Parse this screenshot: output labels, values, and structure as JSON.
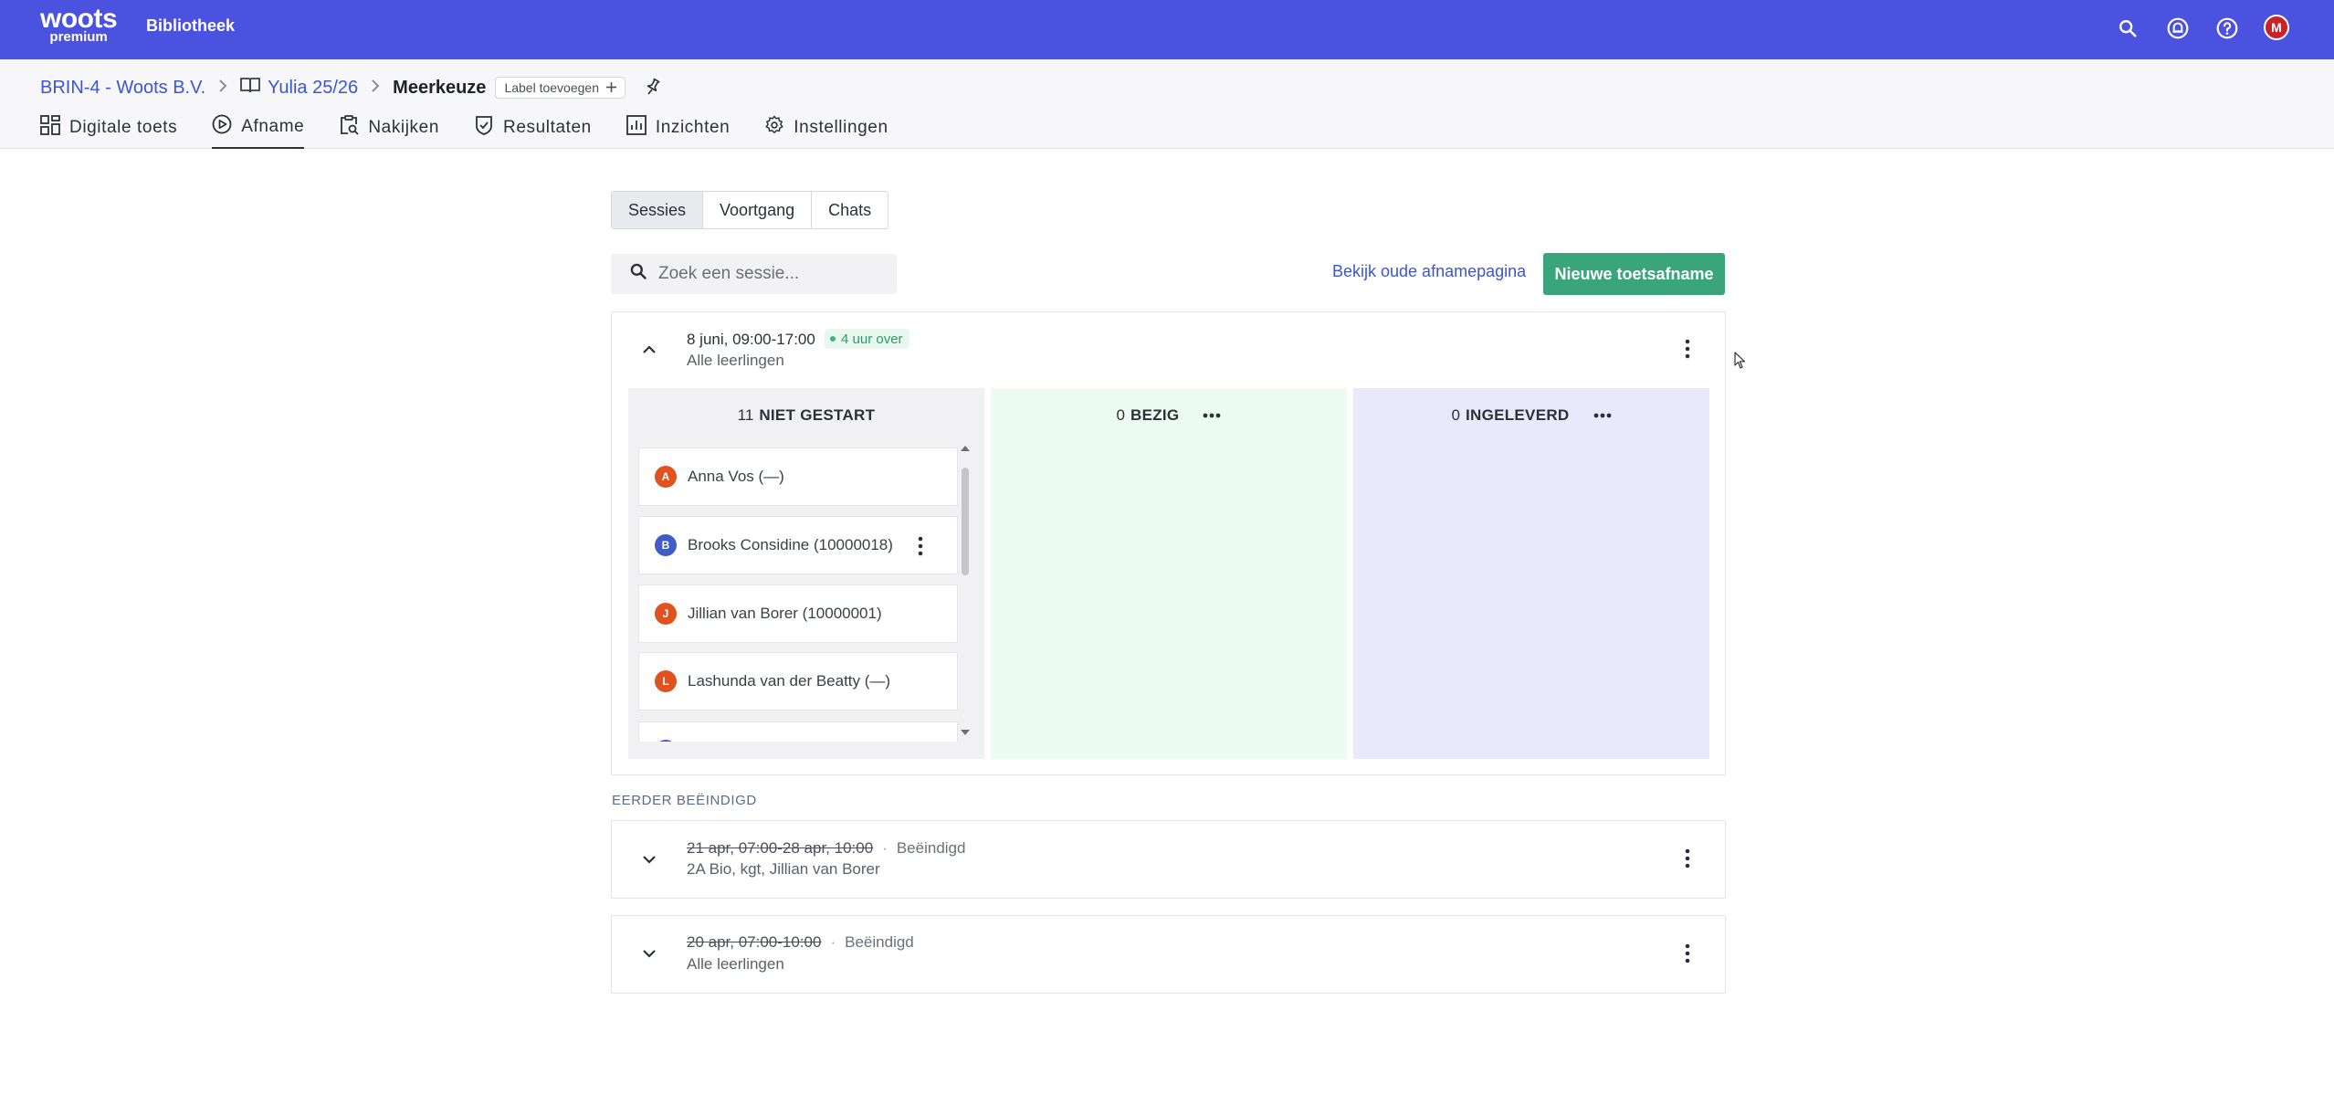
{
  "topbar": {
    "logo_main": "woots",
    "logo_sub": "premium",
    "library_link": "Bibliotheek",
    "avatar_initial": "M",
    "icons": [
      "search-icon",
      "notification-icon",
      "help-icon"
    ]
  },
  "breadcrumb": {
    "org": "BRIN-4 - Woots B.V.",
    "course": "Yulia 25/26",
    "current": "Meerkeuze",
    "label_button": "Label toevoegen"
  },
  "tabs": [
    {
      "label": "Digitale toets",
      "icon": "grid-icon"
    },
    {
      "label": "Afname",
      "icon": "play-icon",
      "active": true
    },
    {
      "label": "Nakijken",
      "icon": "clipboard-search-icon"
    },
    {
      "label": "Resultaten",
      "icon": "shield-check-icon"
    },
    {
      "label": "Inzichten",
      "icon": "bar-chart-icon"
    },
    {
      "label": "Instellingen",
      "icon": "gear-icon"
    }
  ],
  "segments": [
    {
      "label": "Sessies",
      "active": true
    },
    {
      "label": "Voortgang"
    },
    {
      "label": "Chats"
    }
  ],
  "search": {
    "placeholder": "Zoek een sessie..."
  },
  "actions": {
    "old_page_link": "Bekijk oude afnamepagina",
    "new_button": "Nieuwe toetsafname"
  },
  "active_session": {
    "date": "8 juni, 09:00-17:00",
    "badge": "4 uur over",
    "audience": "Alle leerlingen",
    "columns": [
      {
        "count": "11",
        "title": "NIET GESTART"
      },
      {
        "count": "0",
        "title": "BEZIG"
      },
      {
        "count": "0",
        "title": "INGELEVERD"
      }
    ],
    "students": [
      {
        "initial": "A",
        "name": "Anna Vos (—)",
        "color": "#e0531f"
      },
      {
        "initial": "B",
        "name": "Brooks Considine (10000018)",
        "color": "#3f5cc9"
      },
      {
        "initial": "J",
        "name": "Jillian van Borer (10000001)",
        "color": "#e0531f"
      },
      {
        "initial": "L",
        "name": "Lashunda van der Beatty (—)",
        "color": "#e0531f"
      },
      {
        "initial": "",
        "name": "",
        "color": "#3f5cc9"
      }
    ]
  },
  "ended": {
    "section_label": "EERDER BEËINDIGD",
    "sessions": [
      {
        "date": "21 apr, 07:00-28 apr, 10:00",
        "status": "Beëindigd",
        "audience": "2A Bio, kgt, Jillian van Borer"
      },
      {
        "date": "20 apr, 07:00-10:00",
        "status": "Beëindigd",
        "audience": "Alle leerlingen"
      }
    ]
  },
  "colors": {
    "topbar": "#4c52e0",
    "primary_button": "#3aa57a",
    "link": "#3c55d6",
    "col_not_started": "#f1f1f3",
    "col_busy": "#ebfbf2",
    "col_submitted": "#e9e9fb"
  }
}
